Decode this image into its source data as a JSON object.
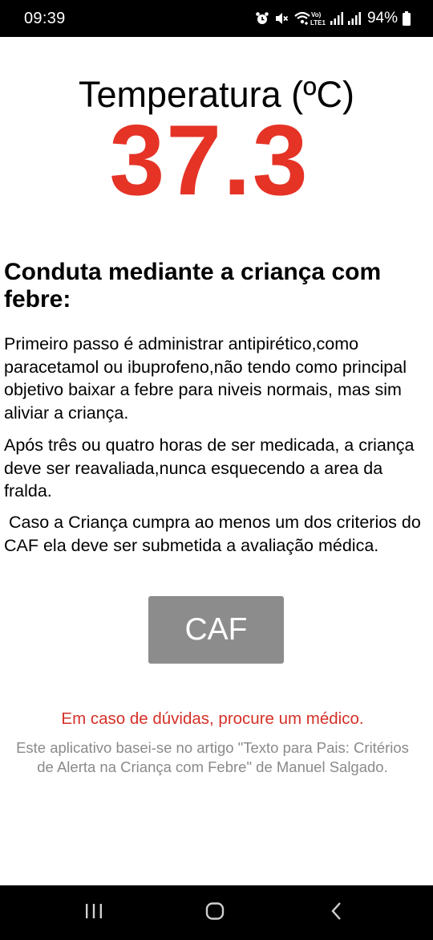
{
  "status_bar": {
    "time": "09:39",
    "network_label_top": "Vo)",
    "network_label_bottom": "LTE1",
    "battery": "94%"
  },
  "main": {
    "temp_title": "Temperatura (ºC)",
    "temp_value": "37.3",
    "heading": "Conduta mediante a criança com febre:",
    "paragraphs": [
      "Primeiro passo é administrar antipirético,como paracetamol ou ibuprofeno,não tendo como principal objetivo baixar a febre para niveis normais, mas sim aliviar a criança.",
      "Após três ou quatro horas de ser medicada, a criança deve ser reavaliada,nunca esquecendo a area da fralda.",
      " Caso a Criança cumpra ao menos um dos criterios do CAF ela deve ser submetida a avaliação médica."
    ],
    "caf_button_label": "CAF",
    "warning": "Em caso de dúvidas, procure um médico.",
    "source": "Este aplicativo basei-se no artigo \"Texto para Pais: Critérios de Alerta na Criança com Febre\" de Manuel Salgado."
  },
  "colors": {
    "temperature": "#e53326",
    "warning": "#d43027",
    "button": "#8c8c8c",
    "source_text": "#8a8a8a"
  },
  "icons": {
    "status": [
      "alarm-icon",
      "mute-icon",
      "wifi-calling-icon",
      "signal-icon",
      "battery-icon"
    ],
    "nav": [
      "recents-icon",
      "home-icon",
      "back-icon"
    ]
  }
}
